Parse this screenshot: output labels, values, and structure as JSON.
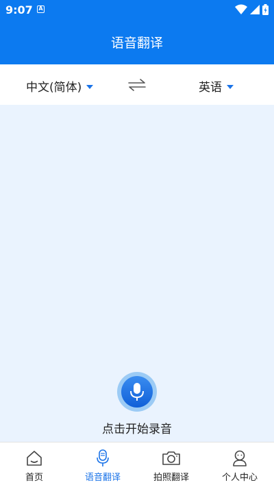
{
  "status": {
    "time": "9:07",
    "notif_letter": "A"
  },
  "app_bar": {
    "title": "语音翻译"
  },
  "languages": {
    "source": "中文(简体)",
    "target": "英语"
  },
  "mic": {
    "label": "点击开始录音"
  },
  "nav": [
    {
      "label": "首页",
      "icon": "home-icon",
      "active": false
    },
    {
      "label": "语音翻译",
      "icon": "microphone-icon",
      "active": true
    },
    {
      "label": "拍照翻译",
      "icon": "camera-icon",
      "active": false
    },
    {
      "label": "个人中心",
      "icon": "profile-icon",
      "active": false
    }
  ],
  "colors": {
    "primary": "#0c7af0",
    "accent": "#1a73e8",
    "background": "#eaf3fe"
  }
}
